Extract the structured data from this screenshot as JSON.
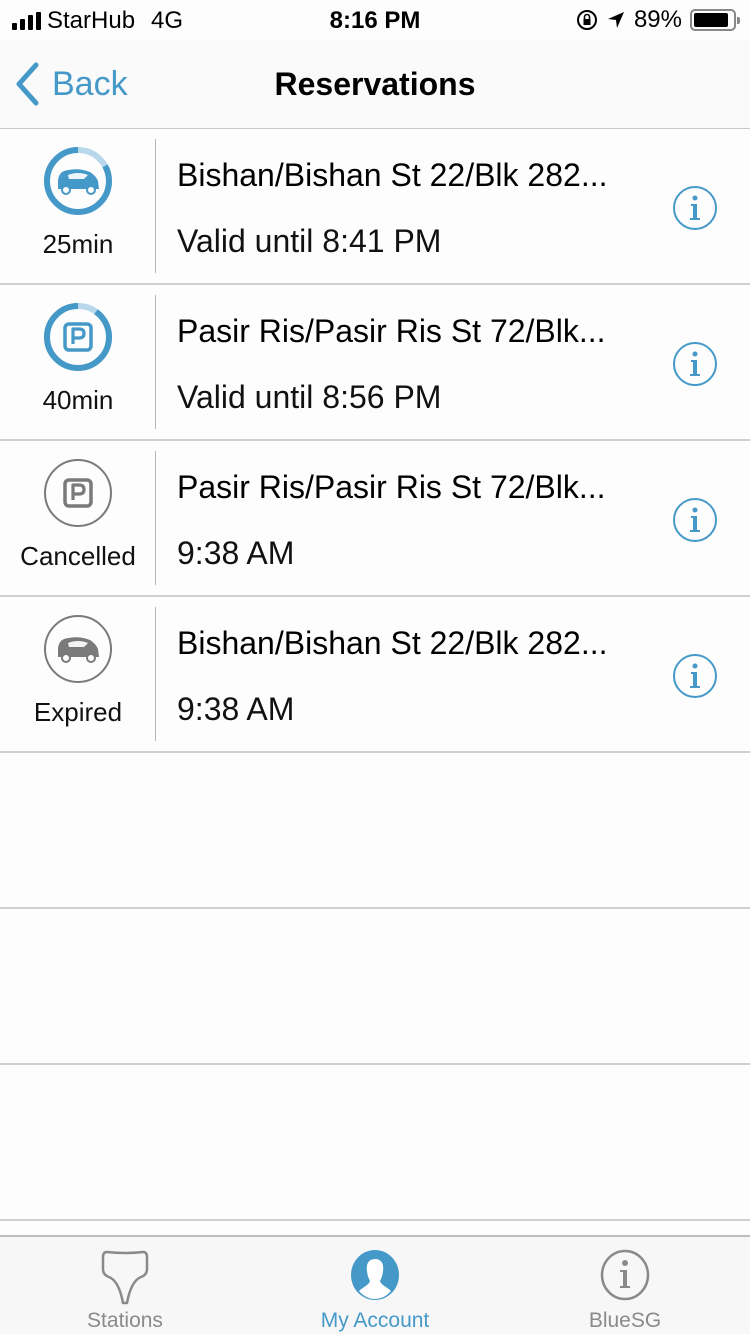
{
  "status_bar": {
    "carrier": "StarHub",
    "network": "4G",
    "time": "8:16 PM",
    "battery_percent": "89%",
    "battery_level": 0.89
  },
  "nav": {
    "back_label": "Back",
    "title": "Reservations"
  },
  "colors": {
    "accent": "#4599c8",
    "inactive": "#8a8a8a",
    "separator": "#cfcfcf"
  },
  "reservations": [
    {
      "type": "car",
      "state": "active",
      "status_label": "25min",
      "remaining_fraction": 0.83,
      "title": "Bishan/Bishan St 22/Blk 282...",
      "subtitle": "Valid until 8:41 PM"
    },
    {
      "type": "parking",
      "state": "active",
      "status_label": "40min",
      "remaining_fraction": 0.9,
      "title": "Pasir Ris/Pasir Ris St 72/Blk...",
      "subtitle": "Valid until 8:56 PM"
    },
    {
      "type": "parking",
      "state": "cancelled",
      "status_label": "Cancelled",
      "title": "Pasir Ris/Pasir Ris St 72/Blk...",
      "subtitle": "9:38 AM"
    },
    {
      "type": "car",
      "state": "expired",
      "status_label": "Expired",
      "title": "Bishan/Bishan St 22/Blk 282...",
      "subtitle": "9:38 AM"
    }
  ],
  "tabs": [
    {
      "label": "Stations",
      "icon": "station-pin-icon",
      "active": false
    },
    {
      "label": "My Account",
      "icon": "account-icon",
      "active": true
    },
    {
      "label": "BlueSG",
      "icon": "info-icon",
      "active": false
    }
  ]
}
